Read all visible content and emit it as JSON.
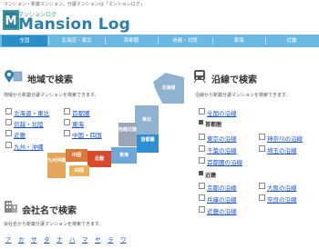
{
  "header": {
    "tagline": "マンション・新築マンション、分譲マンションは「マンションログ」",
    "logo_small": "マンションログ",
    "logo_main": "Mansion Log",
    "logo_letter": "M"
  },
  "nav": {
    "tabs": [
      "全国",
      "北海道・東北",
      "首都圏",
      "信越・北陸",
      "東海",
      "近畿"
    ]
  },
  "area_search": {
    "title": "地域で検索",
    "desc": "地域から新築分譲マンションを検索できます。",
    "links": [
      [
        "北海道・東北",
        "首都圏"
      ],
      [
        "信越・北陸",
        "東海"
      ],
      [
        "近畿",
        "中国・四国"
      ],
      [
        "九州・沖縄"
      ]
    ]
  },
  "map": {
    "regions": [
      "北海道",
      "東北",
      "信越北陸",
      "首都圏",
      "東海",
      "近畿",
      "中国",
      "四国",
      "九州沖縄"
    ],
    "colors": {
      "hokkaido": "#8fb2d0",
      "tohoku": "#8fb2d0",
      "shinetsu": "#9aa7b8",
      "shutoken": "#2f8fd0",
      "tokai": "#6ea7d8",
      "kinki": "#d94a2c",
      "chugoku": "#d97a3a",
      "shikoku": "#e9b25a",
      "kyushu": "#e2a75a"
    }
  },
  "line_search": {
    "title": "沿線で検索",
    "desc": "沿線から新築分譲マンションを検索できます。",
    "all_lines": "全国の沿線",
    "shutoken_label": "首都圏",
    "shutoken_links": [
      [
        "東京の沿線",
        "神奈川の沿線"
      ],
      [
        "千葉の沿線",
        "埼玉の沿線"
      ],
      [
        "首都圏の沿線"
      ]
    ],
    "kinki_label": "近畿",
    "kinki_links": [
      [
        "京都の沿線",
        "大阪の沿線"
      ],
      [
        "兵庫の沿線",
        "奈良の沿線"
      ],
      [
        "近畿の沿線"
      ]
    ]
  },
  "company_search": {
    "title": "会社名で検索",
    "desc": "会社名から新築分譲マンションを検索できます。",
    "kana": [
      "ア",
      "カ",
      "サ",
      "タ",
      "ナ",
      "ハ",
      "マ",
      "ヤ",
      "ラ",
      "ワ"
    ]
  }
}
